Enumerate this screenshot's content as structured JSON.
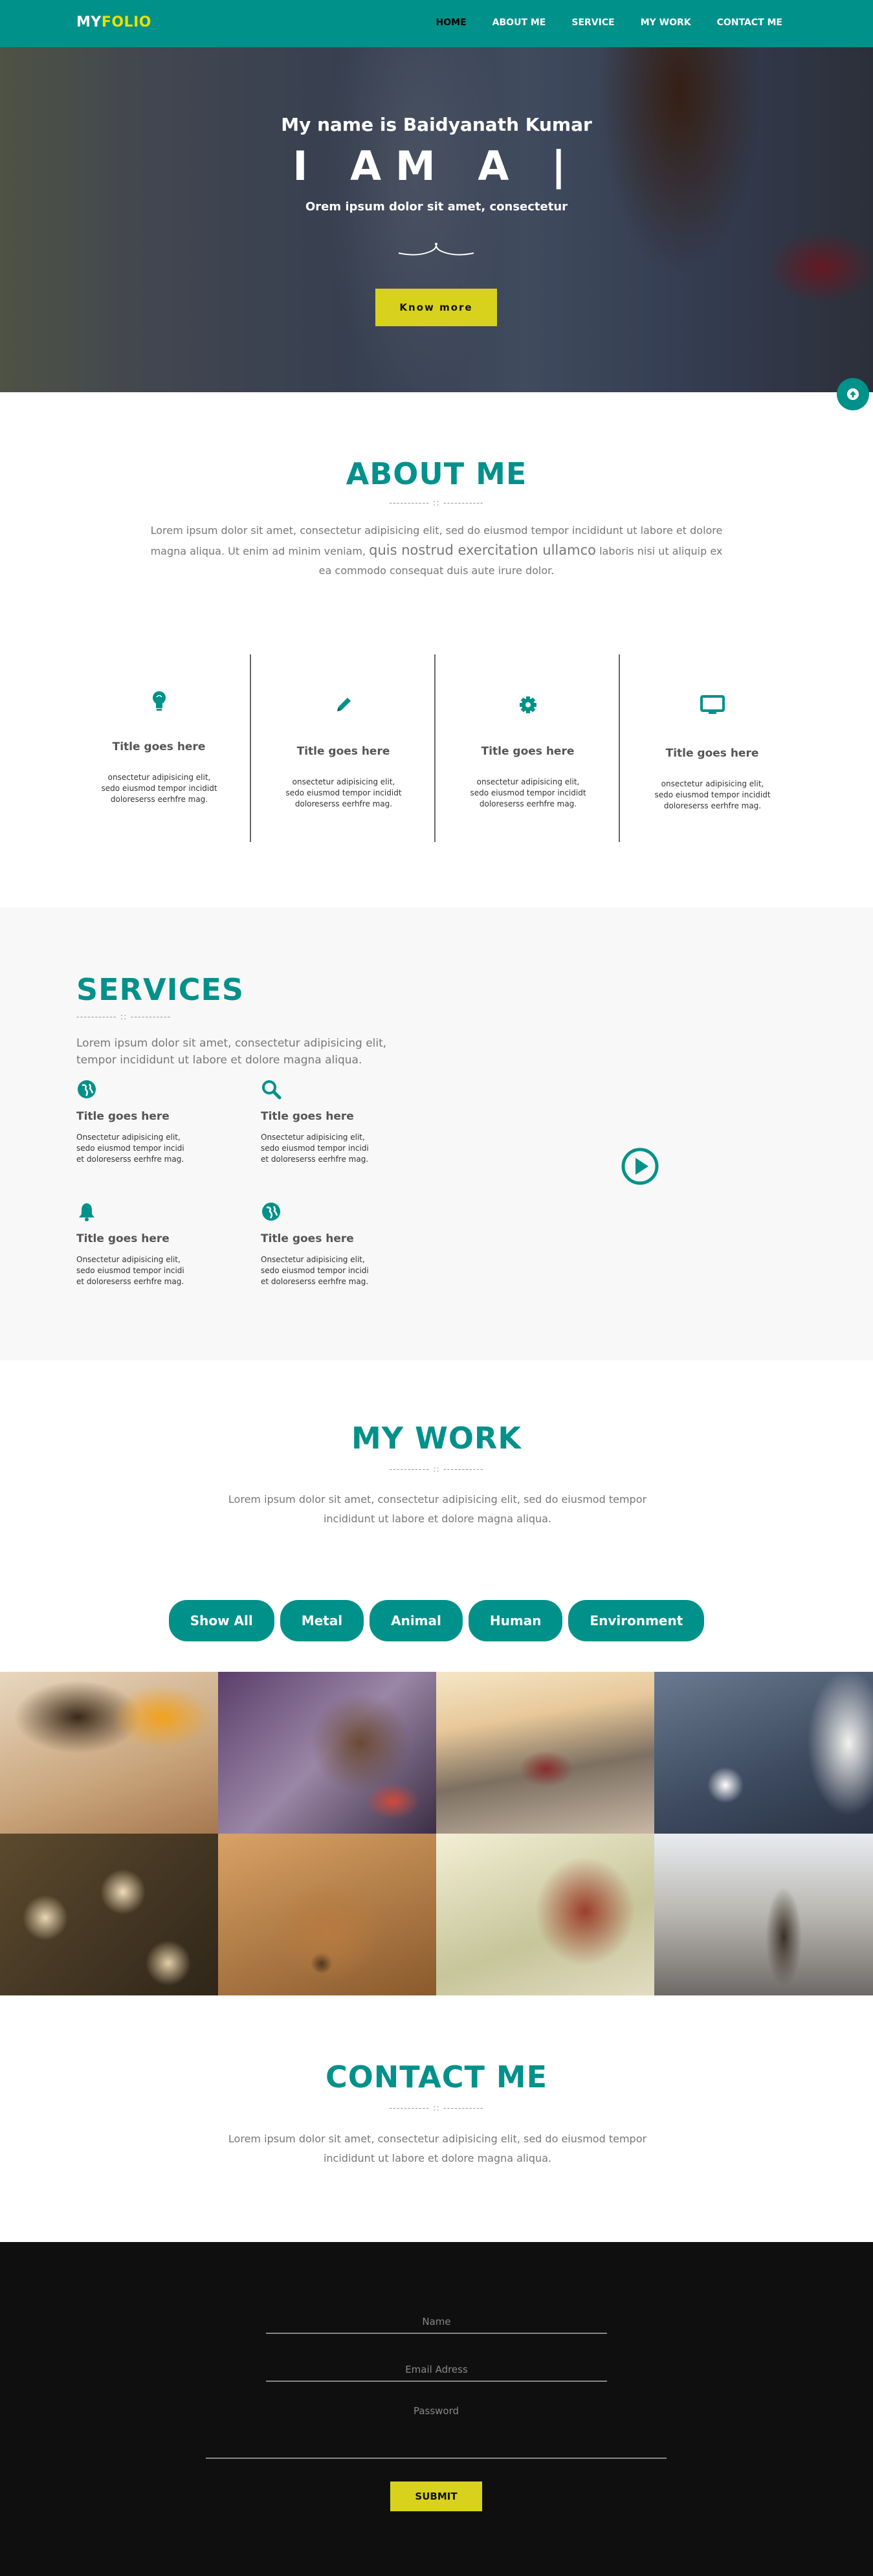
{
  "nav": {
    "logo_part1": "MY",
    "logo_part2": "FOLIO",
    "items": [
      "HOME",
      "ABOUT ME",
      "SERVICE",
      "MY WORK",
      "CONTACT ME"
    ]
  },
  "hero": {
    "name": "My name is Baidyanath Kumar",
    "iam": "I AM A |",
    "subtitle": "Orem ipsum dolor sit amet, consectetur",
    "button": "Know more"
  },
  "about": {
    "title": "ABOUT ME",
    "divider": "-----------  ::  -----------",
    "text_part1": "Lorem ipsum dolor sit amet, consectetur adipisicing elit, sed do eiusmod tempor incididunt ut labore et dolore magna aliqua. Ut enim ad minim veniam, ",
    "text_big": "quis nostrud exercitation ullamco",
    "text_part2": " laboris nisi ut aliquip ex ea commodo consequat duis aute irure dolor.",
    "features": [
      {
        "icon": "lightbulb-icon",
        "title": "Title goes here",
        "text": "onsectetur adipisicing elit, sedo eiusmod tempor incididt doloreserss eerhfre mag."
      },
      {
        "icon": "pencil-icon",
        "title": "Title goes here",
        "text": "onsectetur adipisicing elit, sedo eiusmod tempor incididt doloreserss eerhfre mag."
      },
      {
        "icon": "gear-icon",
        "title": "Title goes here",
        "text": "onsectetur adipisicing elit, sedo eiusmod tempor incididt doloreserss eerhfre mag."
      },
      {
        "icon": "monitor-icon",
        "title": "Title goes here",
        "text": "onsectetur adipisicing elit, sedo eiusmod tempor incididt doloreserss eerhfre mag."
      }
    ]
  },
  "services": {
    "title": "SERVICES",
    "divider": "-----------  ::  -----------",
    "text": "Lorem ipsum dolor sit amet, consectetur adipisicing elit, tempor incididunt ut labore et dolore magna aliqua.",
    "items": [
      {
        "icon": "globe-icon",
        "title": "Title goes here",
        "text": "Onsectetur adipisicing elit, sedo eiusmod tempor incidi et doloreserss eerhfre mag."
      },
      {
        "icon": "search-icon",
        "title": "Title goes here",
        "text": "Onsectetur adipisicing elit, sedo eiusmod tempor incidi et doloreserss eerhfre mag."
      },
      {
        "icon": "bell-icon",
        "title": "Title goes here",
        "text": "Onsectetur adipisicing elit, sedo eiusmod tempor incidi et doloreserss eerhfre mag."
      },
      {
        "icon": "globe-icon",
        "title": "Title goes here",
        "text": "Onsectetur adipisicing elit, sedo eiusmod tempor incidi et doloreserss eerhfre mag."
      }
    ]
  },
  "work": {
    "title": "MY WORK",
    "divider": "-----------  ::  -----------",
    "text": "Lorem ipsum dolor sit amet, consectetur adipisicing elit, sed do eiusmod tempor incididunt ut labore et dolore magna aliqua.",
    "filters": [
      "Show All",
      "Metal",
      "Animal",
      "Human",
      "Environment"
    ]
  },
  "contact": {
    "title": "CONTACT ME",
    "divider": "-----------  ::  -----------",
    "text": "Lorem ipsum dolor sit amet, consectetur adipisicing elit, sed do eiusmod tempor incididunt ut labore et dolore magna aliqua.",
    "name_placeholder": "Name",
    "email_placeholder": "Email Adress",
    "password_placeholder": "Password",
    "submit": "SUBMIT"
  },
  "colors": {
    "accent": "#00918a",
    "button": "#d8d21c",
    "footer": "#0f0f0f"
  }
}
